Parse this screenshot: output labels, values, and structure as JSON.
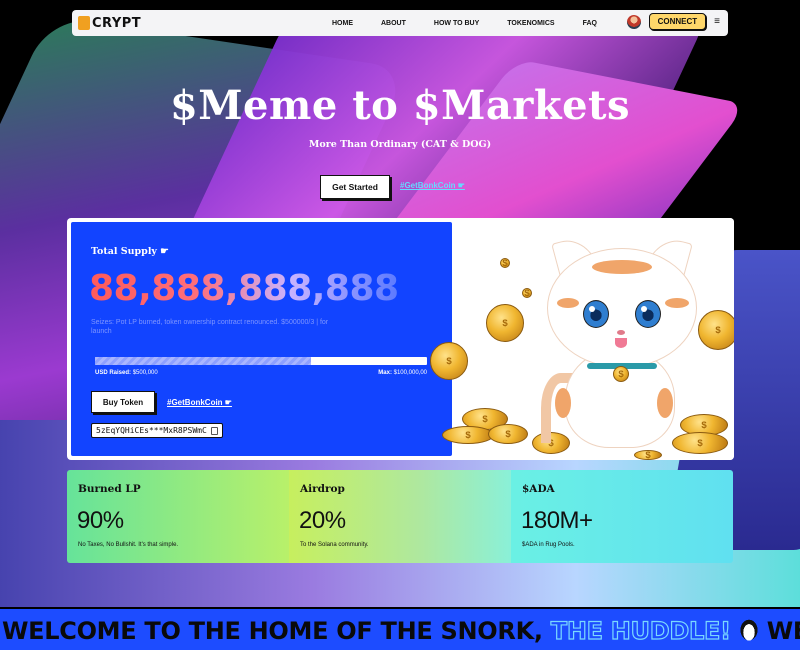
{
  "nav": {
    "logo_text": "CRYPT",
    "items": [
      "HOME",
      "ABOUT",
      "HOW TO BUY",
      "TOKENOMICS",
      "FAQ"
    ],
    "connect_label": "CONNECT",
    "menu_icon": "≡"
  },
  "hero": {
    "title": "$Meme to $Markets",
    "subtitle": "More Than Ordinary (CAT & DOG)",
    "cta_label": "Get Started",
    "link_label": "#GetBonkCoin ☛"
  },
  "token": {
    "supply_label": "Total Supply ☛",
    "supply_value": "88,888,888,888",
    "description": "Seizes: Pot LP burned, token ownership contract renounced. $500000/3 | for launch",
    "progress": 0.65,
    "raised_label": "USD Raised:",
    "raised_value": "$500,000",
    "max_label": "Max:",
    "max_value": "$100,000,00",
    "buy_label": "Buy Token",
    "bonk_link": "#GetBonkCoin ☛",
    "address": "5zEqYQHiCEs***MxR8PSWmC"
  },
  "stats": [
    {
      "title": "Burned LP",
      "value": "90%",
      "desc": "No Taxes, No Bullshit. It's that simple."
    },
    {
      "title": "Airdrop",
      "value": "20%",
      "desc": "To the Solana community."
    },
    {
      "title": "$ADA",
      "value": "180M+",
      "desc": "$ADA in Rug Pools."
    }
  ],
  "marquee": {
    "text1": "WELCOME TO THE HOME OF THE SNORK, ",
    "text2": "THE HUDDLE!",
    "text3": "WELCO"
  },
  "colors": {
    "accent_blue": "#1244ff",
    "connect_yellow": "#ffd76a",
    "marquee_blue": "#1d4cff"
  }
}
